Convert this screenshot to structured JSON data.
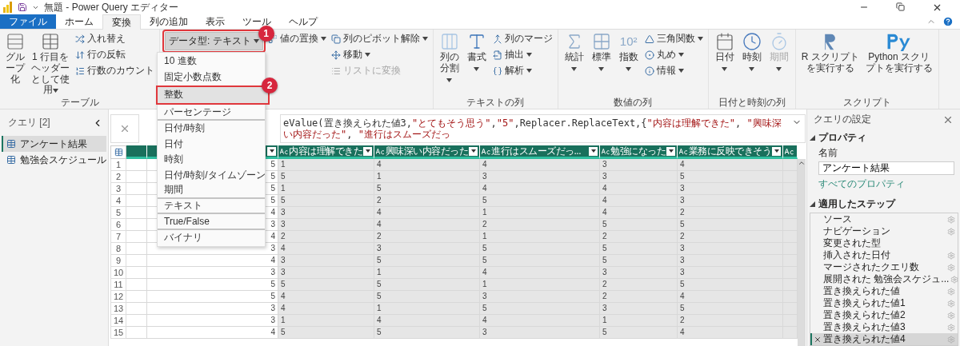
{
  "window": {
    "title": "無題 - Power Query エディター"
  },
  "tabs": [
    {
      "label": "ファイル",
      "kind": "file",
      "selected": false
    },
    {
      "label": "ホーム",
      "kind": "tab",
      "selected": false
    },
    {
      "label": "変換",
      "kind": "tab",
      "selected": true
    },
    {
      "label": "列の追加",
      "kind": "tab",
      "selected": false
    },
    {
      "label": "表示",
      "kind": "tab",
      "selected": false
    },
    {
      "label": "ツール",
      "kind": "tab",
      "selected": false
    },
    {
      "label": "ヘルプ",
      "kind": "tab",
      "selected": false
    }
  ],
  "ribbon": {
    "groups": [
      {
        "label": "テーブル",
        "buttons": [
          {
            "kind": "large",
            "label": "グループ化",
            "caret": false,
            "disabled": false
          },
          {
            "kind": "large",
            "label": "1 行目をヘッダーとして使用",
            "caret": true,
            "disabled": false
          },
          {
            "kind": "stack",
            "items": [
              {
                "label": "入れ替え",
                "caret": false,
                "disabled": false
              },
              {
                "label": "行の反転",
                "caret": false,
                "disabled": false
              },
              {
                "label": "行数のカウント",
                "caret": false,
                "disabled": false
              }
            ]
          }
        ]
      },
      {
        "buttons": [
          {
            "kind": "datatype",
            "label": "データ型: テキスト",
            "caret": true,
            "badge": "1",
            "expanded": true
          },
          {
            "kind": "stack",
            "items": [
              {
                "label": "値の置換",
                "caret": true,
                "disabled": false
              }
            ]
          },
          {
            "kind": "stack",
            "items": [
              {
                "label": "列のピボット解除",
                "caret": true,
                "disabled": false
              },
              {
                "label": "移動",
                "caret": true,
                "disabled": false
              },
              {
                "label": "リストに変換",
                "caret": false,
                "disabled": true
              }
            ]
          }
        ]
      },
      {
        "label": "テキストの列",
        "buttons": [
          {
            "kind": "large",
            "label": "列の分割",
            "caret": true,
            "disabled": false
          },
          {
            "kind": "large",
            "label": "書式",
            "caret": true,
            "disabled": false
          },
          {
            "kind": "stack",
            "items": [
              {
                "label": "列のマージ",
                "caret": false,
                "disabled": false
              },
              {
                "label": "抽出",
                "caret": true,
                "disabled": false
              },
              {
                "label": "解析",
                "caret": true,
                "disabled": false
              }
            ]
          }
        ]
      },
      {
        "label": "数値の列",
        "buttons": [
          {
            "kind": "large",
            "label": "統計",
            "caret": true,
            "disabled": false
          },
          {
            "kind": "large",
            "label": "標準",
            "caret": true,
            "disabled": false
          },
          {
            "kind": "large",
            "label": "指数",
            "caret": true,
            "disabled": false,
            "icon_text": "10²"
          },
          {
            "kind": "stack",
            "items": [
              {
                "label": "三角関数",
                "caret": true,
                "disabled": false
              },
              {
                "label": "丸め",
                "caret": true,
                "disabled": false
              },
              {
                "label": "情報",
                "caret": true,
                "disabled": false
              }
            ]
          }
        ]
      },
      {
        "label": "日付と時刻の列",
        "buttons": [
          {
            "kind": "large",
            "label": "日付",
            "caret": true,
            "disabled": false
          },
          {
            "kind": "large",
            "label": "時刻",
            "caret": true,
            "disabled": false
          },
          {
            "kind": "large",
            "label": "期間",
            "caret": true,
            "disabled": true
          }
        ]
      },
      {
        "label": "スクリプト",
        "buttons": [
          {
            "kind": "large",
            "label": "R スクリプトを実行する",
            "caret": false,
            "disabled": false
          },
          {
            "kind": "large",
            "label": "Python スクリプトを実行する",
            "caret": false,
            "disabled": false
          }
        ]
      }
    ]
  },
  "datatype_menu": [
    {
      "label": "10 進数",
      "highlighted": false,
      "separator": false
    },
    {
      "label": "固定小数点数",
      "highlighted": false,
      "separator": false
    },
    {
      "label": "整数",
      "highlighted": true,
      "separator": false,
      "badge": "2"
    },
    {
      "label": "パーセンテージ",
      "highlighted": false,
      "separator": true
    },
    {
      "label": "日付/時刻",
      "highlighted": false,
      "separator": false
    },
    {
      "label": "日付",
      "highlighted": false,
      "separator": false
    },
    {
      "label": "時刻",
      "highlighted": false,
      "separator": false
    },
    {
      "label": "日付/時刻/タイムゾーン",
      "highlighted": false,
      "separator": false
    },
    {
      "label": "期間",
      "highlighted": false,
      "separator": true
    },
    {
      "label": "テキスト",
      "highlighted": false,
      "separator": true
    },
    {
      "label": "True/False",
      "highlighted": false,
      "separator": true
    },
    {
      "label": "バイナリ",
      "highlighted": false,
      "separator": false
    }
  ],
  "queries": {
    "title": "クエリ",
    "count": "[2]",
    "items": [
      {
        "label": "アンケート結果",
        "selected": true
      },
      {
        "label": "勉強会スケジュール",
        "selected": false
      }
    ]
  },
  "formula_bar": {
    "code_parts": [
      {
        "text": "eValue(置き換えられた値3,",
        "kind": "code"
      },
      {
        "text": "\"とてもそう思う\"",
        "kind": "string"
      },
      {
        "text": ",",
        "kind": "code"
      },
      {
        "text": "\"5\"",
        "kind": "string"
      },
      {
        "text": ",Replacer.ReplaceText,{",
        "kind": "code"
      },
      {
        "text": "\"内容は理解できた\"",
        "kind": "string"
      },
      {
        "text": ", ",
        "kind": "code"
      },
      {
        "text": "\"興味深い内容だった\"",
        "kind": "string"
      },
      {
        "text": ", ",
        "kind": "code"
      },
      {
        "text": "\"進行はスムーズだっ",
        "kind": "string"
      }
    ]
  },
  "table": {
    "columns": [
      {
        "kind": "empty",
        "selected": false
      },
      {
        "kind": "number",
        "selected": false
      },
      {
        "kind": "text",
        "label": "内容は理解できた",
        "selected": true
      },
      {
        "kind": "text",
        "label": "興味深い内容だった",
        "selected": true
      },
      {
        "kind": "text",
        "label": "進行はスムーズだっ...",
        "selected": true
      },
      {
        "kind": "text",
        "label": "勉強になった",
        "selected": true
      },
      {
        "kind": "text",
        "label": "業務に反映できそう",
        "selected": true
      },
      {
        "kind": "cut",
        "selected": true
      }
    ],
    "rows": [
      {
        "number": "1",
        "values": [
          "5",
          "1",
          "4",
          "4",
          "3",
          "4"
        ]
      },
      {
        "number": "2",
        "values": [
          "5",
          "5",
          "1",
          "3",
          "3",
          "5"
        ]
      },
      {
        "number": "3",
        "values": [
          "5",
          "1",
          "5",
          "4",
          "4",
          "3"
        ]
      },
      {
        "number": "4",
        "values": [
          "5",
          "5",
          "2",
          "5",
          "4",
          "3"
        ]
      },
      {
        "number": "5",
        "values": [
          "4",
          "3",
          "4",
          "1",
          "4",
          "2"
        ]
      },
      {
        "number": "6",
        "values": [
          "3",
          "3",
          "4",
          "2",
          "5",
          "5"
        ]
      },
      {
        "number": "7",
        "values": [
          "4",
          "2",
          "2",
          "1",
          "2",
          "2"
        ]
      },
      {
        "number": "8",
        "values": [
          "3",
          "4",
          "3",
          "5",
          "5",
          "3"
        ]
      },
      {
        "number": "9",
        "values": [
          "4",
          "3",
          "5",
          "5",
          "5",
          "3"
        ]
      },
      {
        "number": "10",
        "values": [
          "3",
          "3",
          "1",
          "4",
          "3",
          "3"
        ]
      },
      {
        "number": "11",
        "values": [
          "5",
          "5",
          "5",
          "1",
          "2",
          "5"
        ]
      },
      {
        "number": "12",
        "values": [
          "5",
          "4",
          "5",
          "3",
          "2",
          "4"
        ]
      },
      {
        "number": "13",
        "values": [
          "3",
          "4",
          "1",
          "5",
          "3",
          "5"
        ]
      },
      {
        "number": "14",
        "values": [
          "3",
          "1",
          "4",
          "4",
          "1",
          "2"
        ]
      },
      {
        "number": "15",
        "values": [
          "4",
          "5",
          "5",
          "3",
          "5",
          "4"
        ]
      }
    ]
  },
  "settings": {
    "title": "クエリの設定",
    "properties_heading": "プロパティ",
    "properties_expanded": true,
    "name_label": "名前",
    "name_value": "アンケート結果",
    "all_properties_link": "すべてのプロパティ",
    "steps_heading": "適用したステップ",
    "steps_expanded": true,
    "steps": [
      {
        "label": "ソース",
        "gear": true,
        "selected": false
      },
      {
        "label": "ナビゲーション",
        "gear": true,
        "selected": false
      },
      {
        "label": "変更された型",
        "gear": false,
        "selected": false
      },
      {
        "label": "挿入された日付",
        "gear": true,
        "selected": false
      },
      {
        "label": "マージされたクエリ数",
        "gear": true,
        "selected": false
      },
      {
        "label": "展開された 勉強会スケジュ...",
        "gear": true,
        "selected": false
      },
      {
        "label": "置き換えられた値",
        "gear": true,
        "selected": false
      },
      {
        "label": "置き換えられた値1",
        "gear": true,
        "selected": false
      },
      {
        "label": "置き換えられた値2",
        "gear": true,
        "selected": false
      },
      {
        "label": "置き換えられた値3",
        "gear": true,
        "selected": false
      },
      {
        "label": "置き換えられた値4",
        "gear": true,
        "selected": true
      }
    ]
  }
}
